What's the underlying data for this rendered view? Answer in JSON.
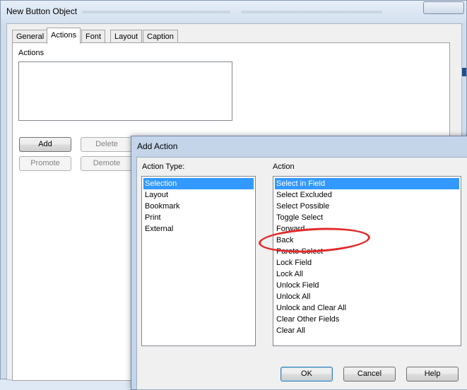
{
  "background_window": {
    "title": "New Button Object",
    "tabs": [
      "General",
      "Actions",
      "Font",
      "Layout",
      "Caption"
    ],
    "active_tab": "Actions",
    "actions_label": "Actions",
    "buttons": {
      "add": "Add",
      "delete": "Delete",
      "promote": "Promote",
      "demote": "Demote"
    }
  },
  "dialog": {
    "title": "Add Action",
    "action_type_label": "Action Type:",
    "action_label": "Action",
    "action_types": [
      "Selection",
      "Layout",
      "Bookmark",
      "Print",
      "External"
    ],
    "selected_action_type": "Selection",
    "actions": [
      "Select in Field",
      "Select Excluded",
      "Select Possible",
      "Toggle Select",
      "Forward",
      "Back",
      "Pareto Select",
      "Lock Field",
      "Lock All",
      "Unlock Field",
      "Unlock All",
      "Unlock and Clear All",
      "Clear Other Fields",
      "Clear All"
    ],
    "selected_action": "Select in Field",
    "buttons": {
      "ok": "OK",
      "cancel": "Cancel",
      "help": "Help"
    }
  },
  "annotation": {
    "shape": "ellipse",
    "color": "#e32a2a",
    "highlights": "Toggle Select"
  },
  "colors": {
    "selection": "#3399ff",
    "window_frame": "#cfdcec"
  }
}
